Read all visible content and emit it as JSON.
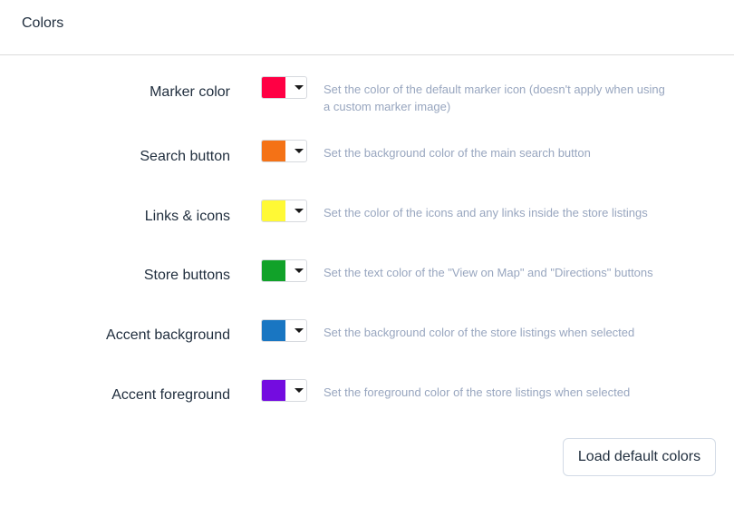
{
  "header": {
    "title": "Colors"
  },
  "rows": [
    {
      "label": "Marker color",
      "color": "#ff0044",
      "description": "Set the color of the default marker icon (doesn't apply when using a custom marker image)"
    },
    {
      "label": "Search button",
      "color": "#f47216",
      "description": "Set the background color of the main search button"
    },
    {
      "label": "Links & icons",
      "color": "#fff935",
      "description": "Set the color of the icons and any links inside the store listings"
    },
    {
      "label": "Store buttons",
      "color": "#11a229",
      "description": "Set the text color of the \"View on Map\" and \"Directions\" buttons"
    },
    {
      "label": "Accent background",
      "color": "#1976c2",
      "description": "Set the background color of the store listings when selected"
    },
    {
      "label": "Accent foreground",
      "color": "#740ce0",
      "description": "Set the foreground color of the store listings when selected"
    }
  ],
  "actions": {
    "load_defaults_label": "Load default colors"
  }
}
